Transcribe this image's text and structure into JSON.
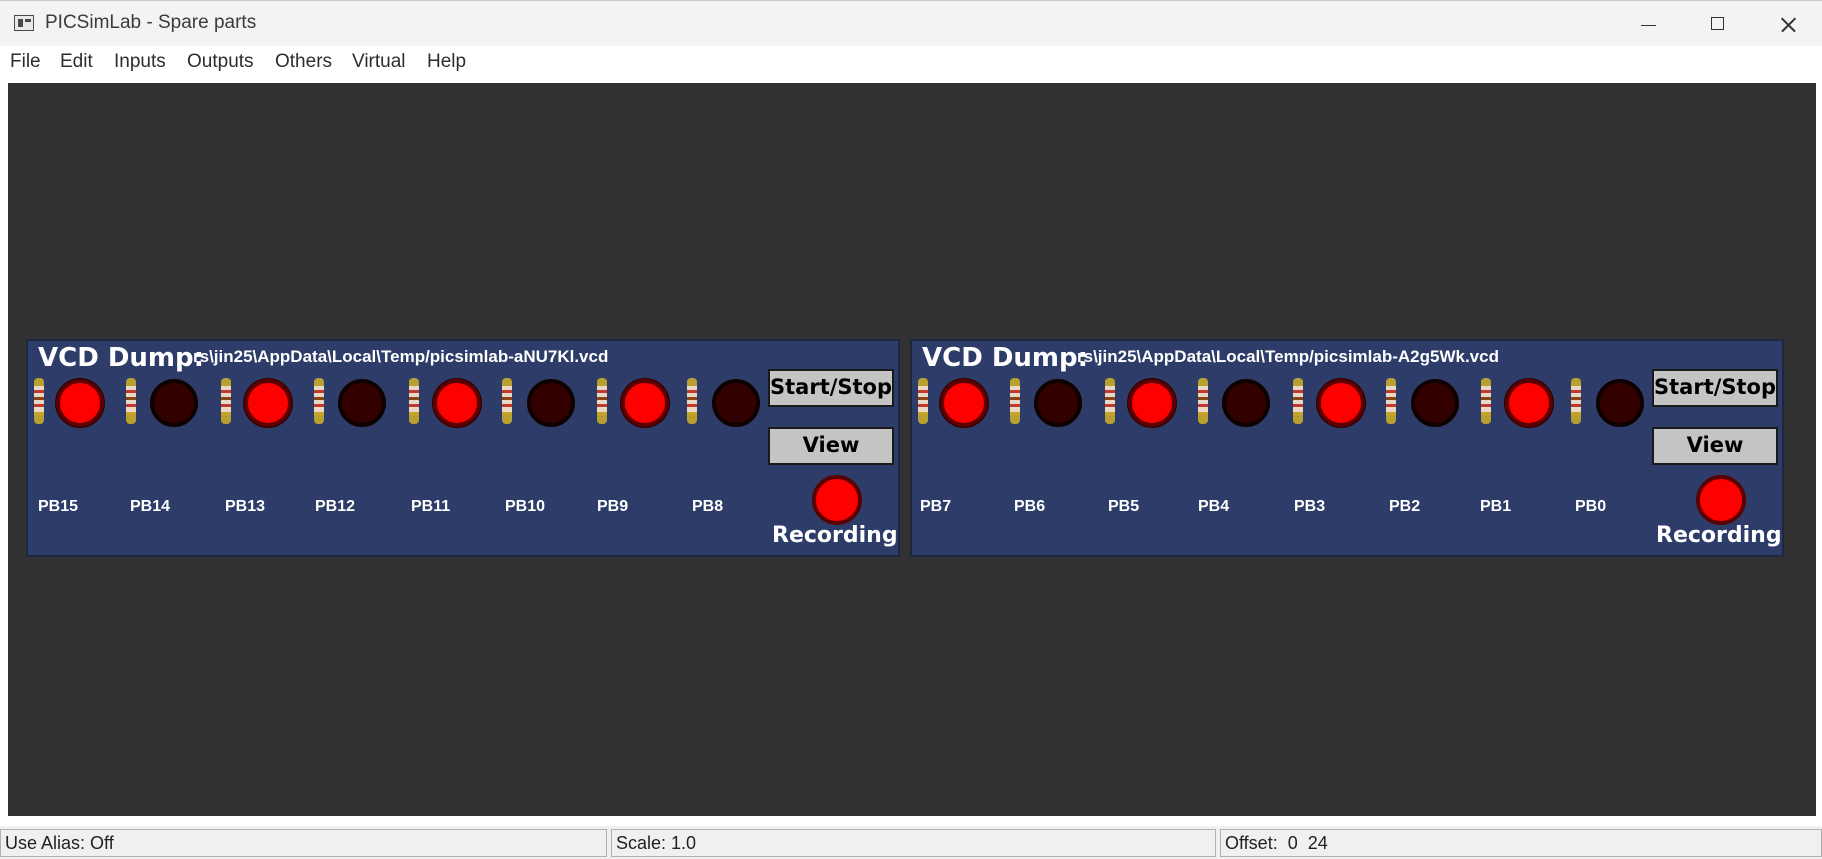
{
  "window": {
    "title": "PICSimLab - Spare parts",
    "controls": [
      "minimize-icon",
      "maximize-icon",
      "close-icon"
    ]
  },
  "menu": [
    "File",
    "Edit",
    "Inputs",
    "Outputs",
    "Others",
    "Virtual",
    "Help"
  ],
  "panels": [
    {
      "title": "VCD Dump:",
      "file": "rs\\jin25\\AppData\\Local\\Temp/picsimlab-aNU7Kl.vcd",
      "pins": [
        "PB15",
        "PB14",
        "PB13",
        "PB12",
        "PB11",
        "PB10",
        "PB9",
        "PB8"
      ],
      "led_on": [
        true,
        false,
        true,
        false,
        true,
        false,
        true,
        false
      ],
      "start_stop": "Start/Stop",
      "view": "View",
      "recording": "Recording"
    },
    {
      "title": "VCD Dump:",
      "file": "rs\\jin25\\AppData\\Local\\Temp/picsimlab-A2g5Wk.vcd",
      "pins": [
        "PB7",
        "PB6",
        "PB5",
        "PB4",
        "PB3",
        "PB2",
        "PB1",
        "PB0"
      ],
      "led_on": [
        true,
        false,
        true,
        false,
        true,
        false,
        true,
        false
      ],
      "start_stop": "Start/Stop",
      "view": "View",
      "recording": "Recording"
    }
  ],
  "status": {
    "alias": "Use Alias: Off",
    "scale": "Scale: 1.0",
    "offset": "Offset:  0  24"
  },
  "colors": {
    "workspace": "#323232",
    "panel": "#2d3c68",
    "led_on": "#ff0000",
    "led_off": "#330000"
  }
}
